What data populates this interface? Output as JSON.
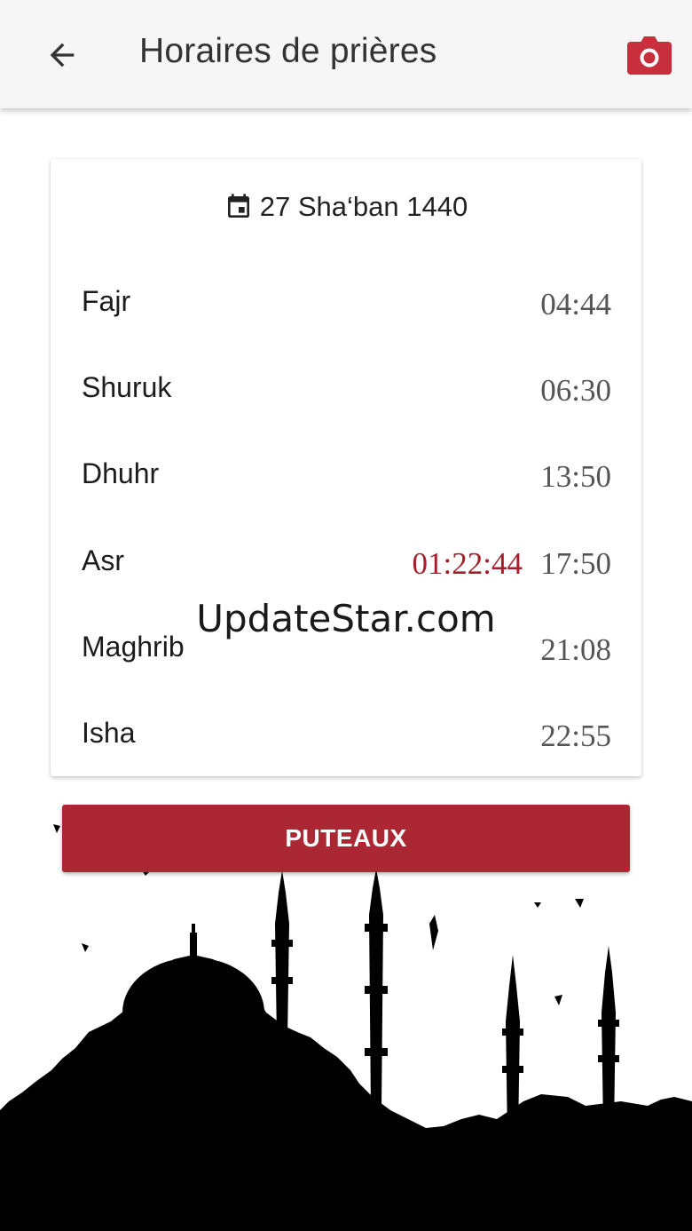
{
  "appbar": {
    "title": "Horaires de prières",
    "back_icon": "arrow-left-icon",
    "action_icon": "camera-icon",
    "accent_color": "#c62f3b"
  },
  "card": {
    "date": "27 Sha‘ban 1440",
    "date_icon": "calendar-icon",
    "prayers": [
      {
        "name": "Fajr",
        "time": "04:44"
      },
      {
        "name": "Shuruk",
        "time": "06:30"
      },
      {
        "name": "Dhuhr",
        "time": "13:50"
      },
      {
        "name": "Asr",
        "time": "17:50",
        "countdown": "01:22:44"
      },
      {
        "name": "Maghrib",
        "time": "21:08"
      },
      {
        "name": "Isha",
        "time": "22:55"
      }
    ]
  },
  "city_button": {
    "label": "PUTEAUX",
    "color": "#ab2733"
  },
  "watermark": "UpdateStar.com",
  "background_image": "mosque-silhouette"
}
